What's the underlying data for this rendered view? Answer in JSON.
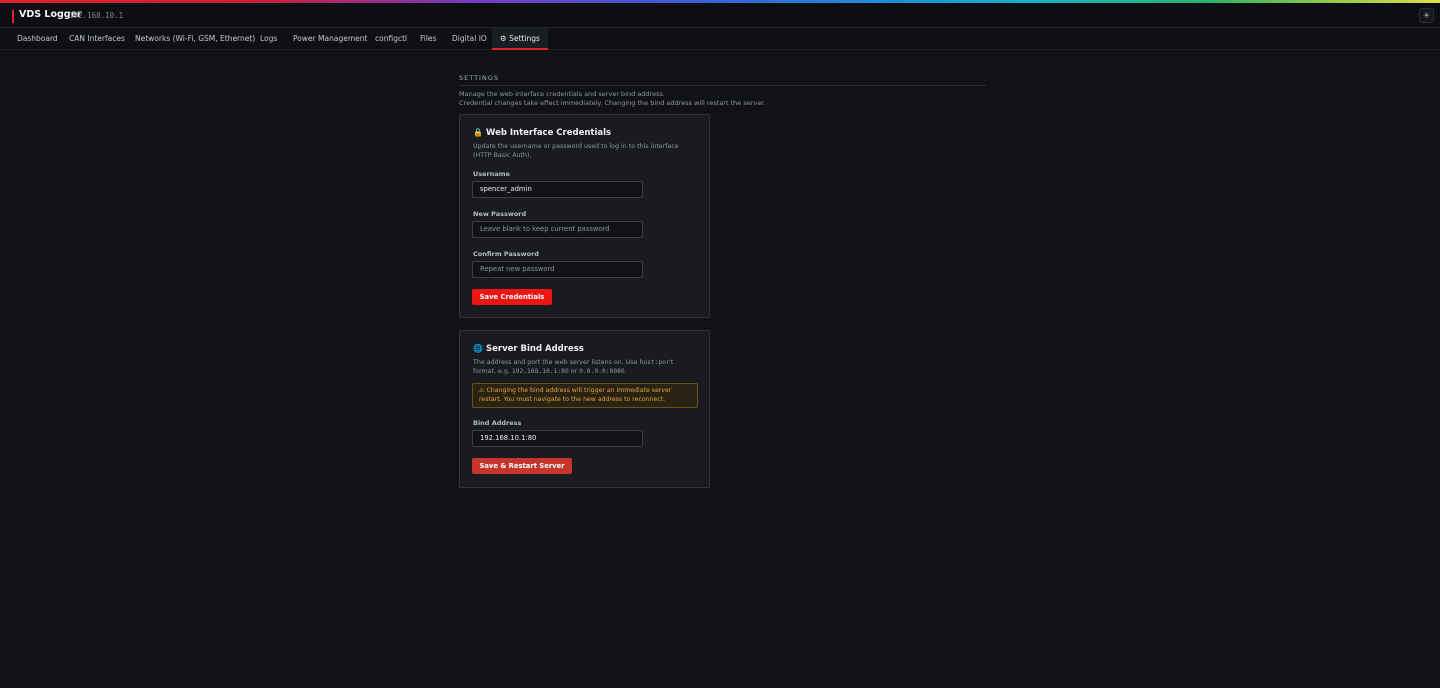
{
  "app": {
    "title": "VDS Logger",
    "ip": "192.168.10.1",
    "theme_icon": "sun-icon",
    "theme_glyph": "☀"
  },
  "nav": {
    "items": [
      {
        "label": "Dashboard"
      },
      {
        "label": "CAN Interfaces"
      },
      {
        "label": "Networks (Wi-Fi, GSM, Ethernet)"
      },
      {
        "label": "Logs"
      },
      {
        "label": "Power Management"
      },
      {
        "label": "configctl"
      },
      {
        "label": "Files"
      },
      {
        "label": "Digital IO"
      },
      {
        "label": "⚙ Settings",
        "active": true
      }
    ]
  },
  "settings": {
    "heading": "SETTINGS",
    "desc_line1": "Manage the web interface credentials and server bind address.",
    "desc_line2": "Credential changes take effect immediately. Changing the bind address will restart the server."
  },
  "credentials": {
    "icon": "lock-icon",
    "icon_glyph": "🔒",
    "title": "Web Interface Credentials",
    "desc_line1": "Update the username or password used to log in to this interface",
    "desc_line2": "(HTTP Basic Auth).",
    "username_label": "Username",
    "username_value": "spencer_admin",
    "new_password_label": "New Password",
    "new_password_placeholder": "Leave blank to keep current password",
    "confirm_password_label": "Confirm Password",
    "confirm_password_placeholder": "Repeat new password",
    "save_label": "Save Credentials"
  },
  "bind": {
    "icon": "globe-icon",
    "icon_glyph": "🌐",
    "title": "Server Bind Address",
    "desc_line1_a": "The address and port the web server listens on. Use ",
    "desc_line1_code": "host:port",
    "desc_line2_a": "format, e.g. ",
    "desc_line2_code1": "192.168.10.1:80",
    "desc_line2_b": " or ",
    "desc_line2_code2": "0.0.0.0:8080",
    "desc_line2_c": ".",
    "warning_line1": "⚠ Changing the bind address will trigger an immediate server",
    "warning_line2": "restart. You must navigate to the new address to reconnect.",
    "address_label": "Bind Address",
    "address_value": "192.168.10.1:80",
    "save_label": "Save & Restart Server"
  },
  "colors": {
    "accent": "#e0222a",
    "button_primary": "#ee1414",
    "button_restart": "#c6352c",
    "warning_text": "#e0a53a"
  }
}
